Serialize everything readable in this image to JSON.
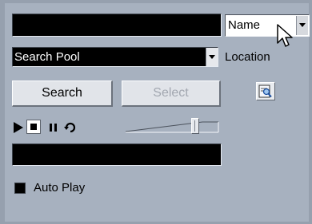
{
  "pool_name_field": {
    "value": ""
  },
  "search_attribute": {
    "selected": "Name"
  },
  "search_location": {
    "selected": "Search Pool",
    "label": "Location"
  },
  "buttons": {
    "search": "Search",
    "select": "Select"
  },
  "transport": {
    "icons": [
      "play-icon",
      "stop-icon",
      "pause-icon",
      "loop-icon",
      "locate-icon"
    ],
    "volume_level": 0.8
  },
  "result_display": {
    "value": ""
  },
  "auto_play": {
    "label": "Auto Play",
    "checked": true
  },
  "colors": {
    "panel": "#a7b1bf",
    "field": "#000000",
    "button": "#e1e4e9",
    "disabled_text": "#a2a7b0"
  }
}
